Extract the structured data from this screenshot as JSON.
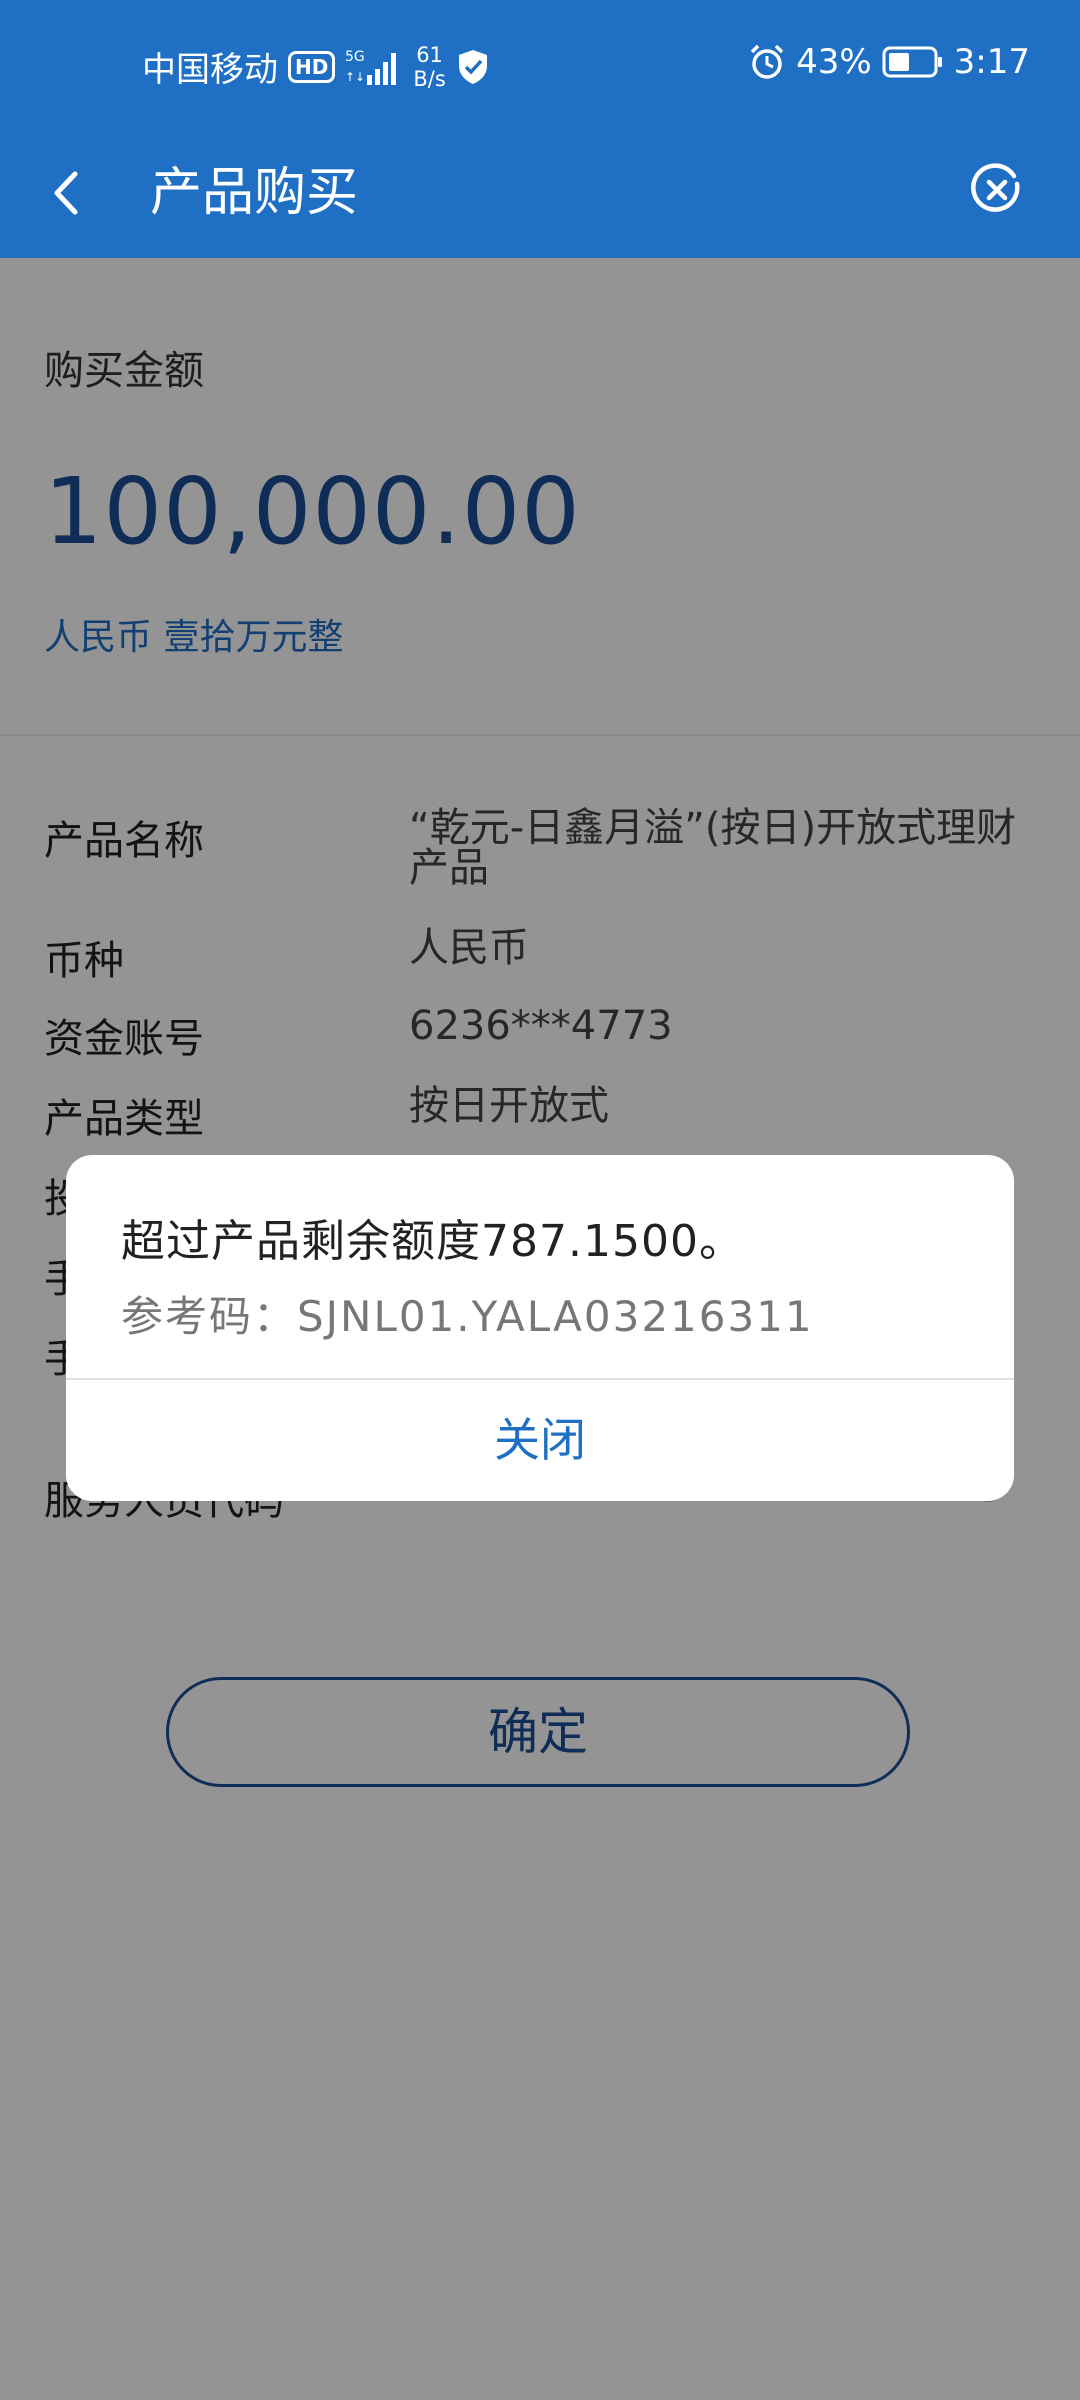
{
  "status_bar": {
    "carrier": "中国移动",
    "hd_badge": "HD",
    "net_speed_value": "61",
    "net_speed_unit": "B/s",
    "battery": "43%",
    "time": "3:17",
    "icons": [
      "signal-5g-icon",
      "shield-icon",
      "alarm-icon",
      "battery-icon"
    ]
  },
  "header": {
    "title": "产品购买",
    "icons": [
      "back-icon",
      "close-circle-icon"
    ]
  },
  "amount": {
    "label": "购买金额",
    "value": "100,000.00",
    "in_words": "人民币 壹拾万元整"
  },
  "details": [
    {
      "label": "产品名称",
      "value": "“乾元-日鑫月溢”(按日)开放式理财产品"
    },
    {
      "label": "币种",
      "value": "人民币"
    },
    {
      "label": "资金账号",
      "value": "6236***4773"
    },
    {
      "label": "产品类型",
      "value": "按日开放式"
    }
  ],
  "partially_visible": {
    "row5_char": "投",
    "row6_char": "手",
    "row7_char": "手",
    "service_text": "服务人员代码"
  },
  "confirm_button": "确定",
  "dialog": {
    "message": "超过产品剩余额度787.1500。",
    "reference": "参考码：SJNL01.YALA03216311",
    "close_button": "关闭"
  },
  "colors": {
    "brand_blue": "#1f6fc4",
    "amount_blue": "#1a4f94",
    "overlay": "rgba(0,0,0,0.42)"
  }
}
